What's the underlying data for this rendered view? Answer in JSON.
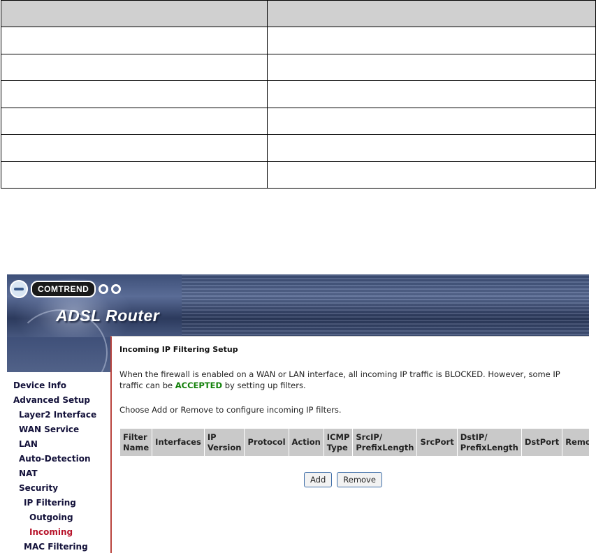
{
  "doc_table": {
    "rows": 7,
    "columns": 2
  },
  "router": {
    "brand": "COMTREND",
    "product_title": "ADSL Router",
    "page_title": "Incoming IP Filtering Setup",
    "description_part1": "When the firewall is enabled on a WAN or LAN interface, all incoming IP traffic is BLOCKED. However, some IP traffic can be",
    "description_accepted": "ACCEPTED",
    "description_part2": "by setting up filters.",
    "instruction": "Choose Add or Remove to configure incoming IP filters.",
    "table_headers": [
      [
        "Filter",
        "Name"
      ],
      [
        "Interfaces",
        ""
      ],
      [
        "IP",
        "Version"
      ],
      [
        "Protocol",
        ""
      ],
      [
        "Action",
        ""
      ],
      [
        "ICMP",
        "Type"
      ],
      [
        "SrcIP/",
        "PrefixLength"
      ],
      [
        "SrcPort",
        ""
      ],
      [
        "DstIP/",
        "PrefixLength"
      ],
      [
        "DstPort",
        ""
      ],
      [
        "Remove",
        ""
      ]
    ],
    "buttons": {
      "add": "Add",
      "remove": "Remove"
    },
    "menu": [
      "Device Info",
      "Advanced Setup",
      "Layer2 Interface",
      "WAN Service",
      "LAN",
      "Auto-Detection",
      "NAT",
      "Security",
      "IP Filtering",
      "Outgoing",
      "Incoming",
      "MAC Filtering"
    ],
    "colors": {
      "accepted": "#12800a",
      "active_menu": "#b7132a",
      "menu_text": "#13113a",
      "table_header_bg": "#c9c9c9"
    }
  }
}
